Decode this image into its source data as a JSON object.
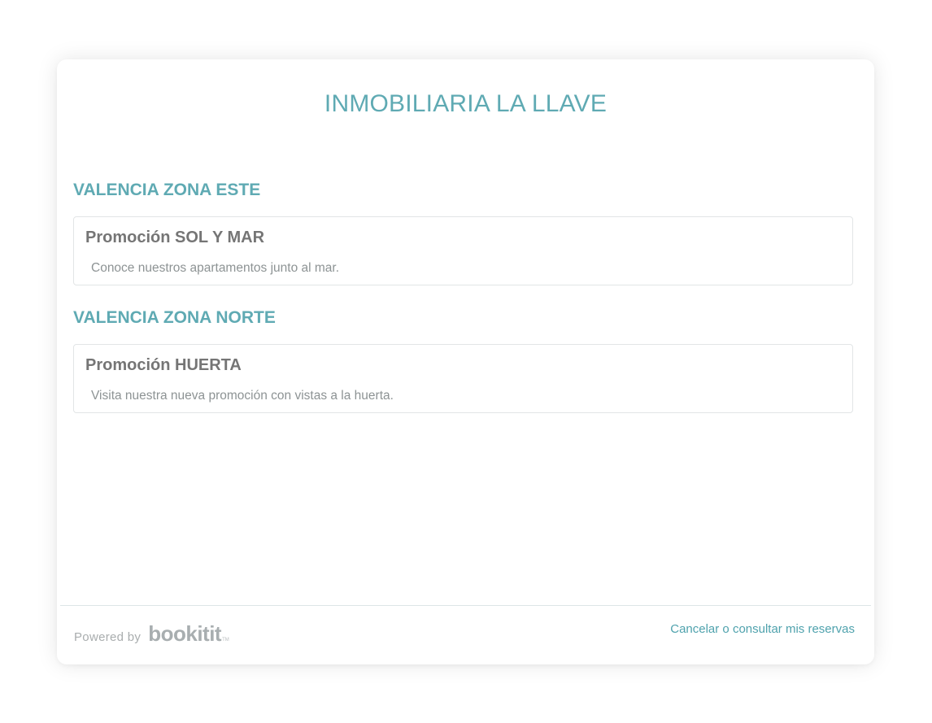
{
  "header": {
    "title": "INMOBILIARIA LA LLAVE"
  },
  "sections": [
    {
      "heading": "VALENCIA ZONA ESTE",
      "promotions": [
        {
          "name": "Promoción SOL Y MAR",
          "description": "Conoce nuestros apartamentos junto al mar."
        }
      ]
    },
    {
      "heading": "VALENCIA ZONA NORTE",
      "promotions": [
        {
          "name": "Promoción HUERTA",
          "description": "Visita nuestra nueva promoción con vistas a la huerta."
        }
      ]
    }
  ],
  "footer": {
    "powered_by": "Powered by",
    "logo_text": "bookitit",
    "logo_tm": "TM",
    "manage_link": "Cancelar o consultar mis reservas"
  },
  "colors": {
    "accent": "#5faab3",
    "link": "#4fa2ad",
    "promo_title": "#757575",
    "promo_text": "#8d9394"
  }
}
